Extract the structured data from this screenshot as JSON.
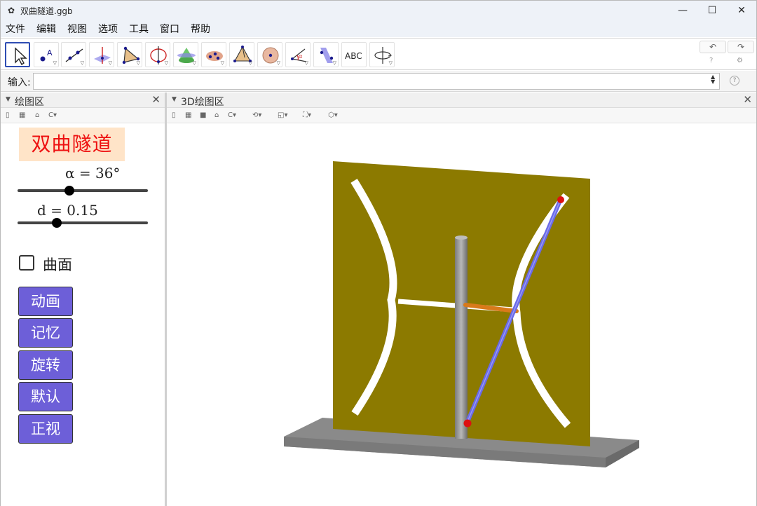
{
  "window": {
    "title": "双曲隧道.ggb",
    "controls": {
      "minimize": "—",
      "maximize": "☐",
      "close": "✕"
    }
  },
  "menu": [
    "文件",
    "编辑",
    "视图",
    "选项",
    "工具",
    "窗口",
    "帮助"
  ],
  "toolbar": {
    "tools": [
      {
        "name": "move-tool",
        "icon": "arrow-cursor-icon"
      },
      {
        "name": "point-tool",
        "icon": "point-icon"
      },
      {
        "name": "line-tool",
        "icon": "line-icon"
      },
      {
        "name": "perpendicular-line-tool",
        "icon": "perpendicular-icon"
      },
      {
        "name": "polygon-tool",
        "icon": "triangle-icon"
      },
      {
        "name": "circle-tool",
        "icon": "circle-axis-icon"
      },
      {
        "name": "intersect-tool",
        "icon": "cone-icon"
      },
      {
        "name": "plane-tool",
        "icon": "plane-points-icon"
      },
      {
        "name": "pyramid-tool",
        "icon": "pyramid-icon"
      },
      {
        "name": "sphere-tool",
        "icon": "sphere-icon"
      },
      {
        "name": "angle-tool",
        "icon": "angle-icon"
      },
      {
        "name": "reflect-tool",
        "icon": "reflect-plane-icon"
      },
      {
        "name": "text-tool",
        "icon": "abc-icon",
        "label": "ABC"
      },
      {
        "name": "rotate-view-tool",
        "icon": "rotate-view-icon"
      }
    ],
    "undo": "↶",
    "redo": "↷"
  },
  "input_bar": {
    "label": "输入:",
    "value": ""
  },
  "left_panel": {
    "title": "绘图区",
    "heading": "双曲隧道",
    "sliders": [
      {
        "label": "α = 36°",
        "value_deg": 36
      },
      {
        "label": "d = 0.15",
        "value": 0.15
      }
    ],
    "checkbox": {
      "label": "曲面",
      "checked": false
    },
    "buttons": [
      "动画",
      "记忆",
      "旋转",
      "默认",
      "正视"
    ]
  },
  "right_panel": {
    "title": "3D绘图区"
  },
  "colors": {
    "panel_board": "#8c7a00",
    "button_fill": "#6d5fd8",
    "title_red": "#ee1111",
    "title_bg": "#ffe4c8",
    "rod_blue": "#6a6ae8",
    "bar_orange": "#d87a1a",
    "point_red": "#dd1111"
  }
}
